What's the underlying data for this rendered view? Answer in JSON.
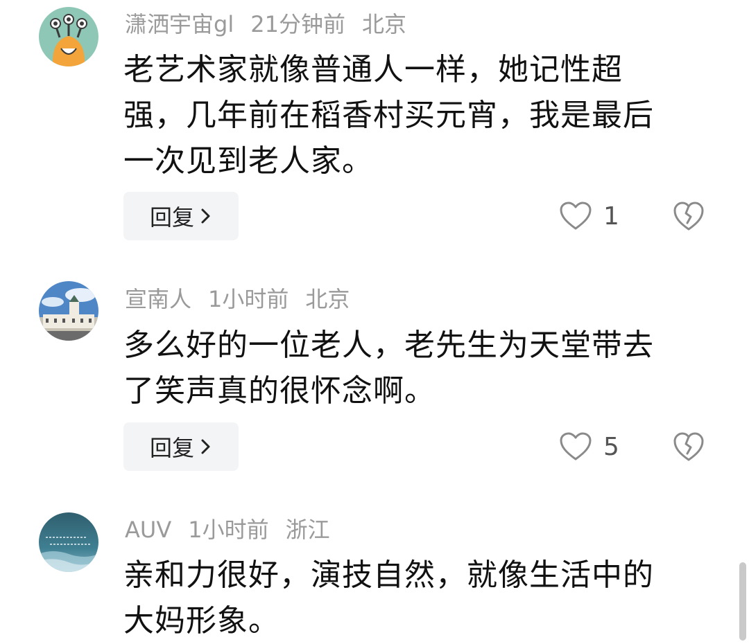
{
  "comments": [
    {
      "username": "潇洒宇宙gl",
      "time": "21分钟前",
      "location": "北京",
      "lines": [
        "老艺术家就像普通人一样，她记性超",
        "强，几年前在稻香村买元宵，我是最后",
        "一次见到老人家。"
      ],
      "reply_label": "回复",
      "likes": "1",
      "avatar": "monster-avatar"
    },
    {
      "username": "宣南人",
      "time": "1小时前",
      "location": "北京",
      "lines": [
        "多么好的一位老人，老先生为天堂带去",
        "了笑声真的很怀念啊。"
      ],
      "reply_label": "回复",
      "likes": "5",
      "avatar": "building-avatar"
    },
    {
      "username": "AUV",
      "time": "1小时前",
      "location": "浙江",
      "lines": [
        "亲和力很好，演技自然，就像生活中的",
        "大妈形象。"
      ],
      "avatar": "ocean-avatar"
    }
  ],
  "icons": {
    "like": "heart-outline-icon",
    "dislike": "broken-heart-icon",
    "reply_chevron": "chevron-right-icon"
  },
  "colors": {
    "meta_text": "#9a9a9a",
    "body_text": "#111111",
    "reply_bg": "#f3f4f5",
    "icon_gray": "#8a8a8a"
  }
}
